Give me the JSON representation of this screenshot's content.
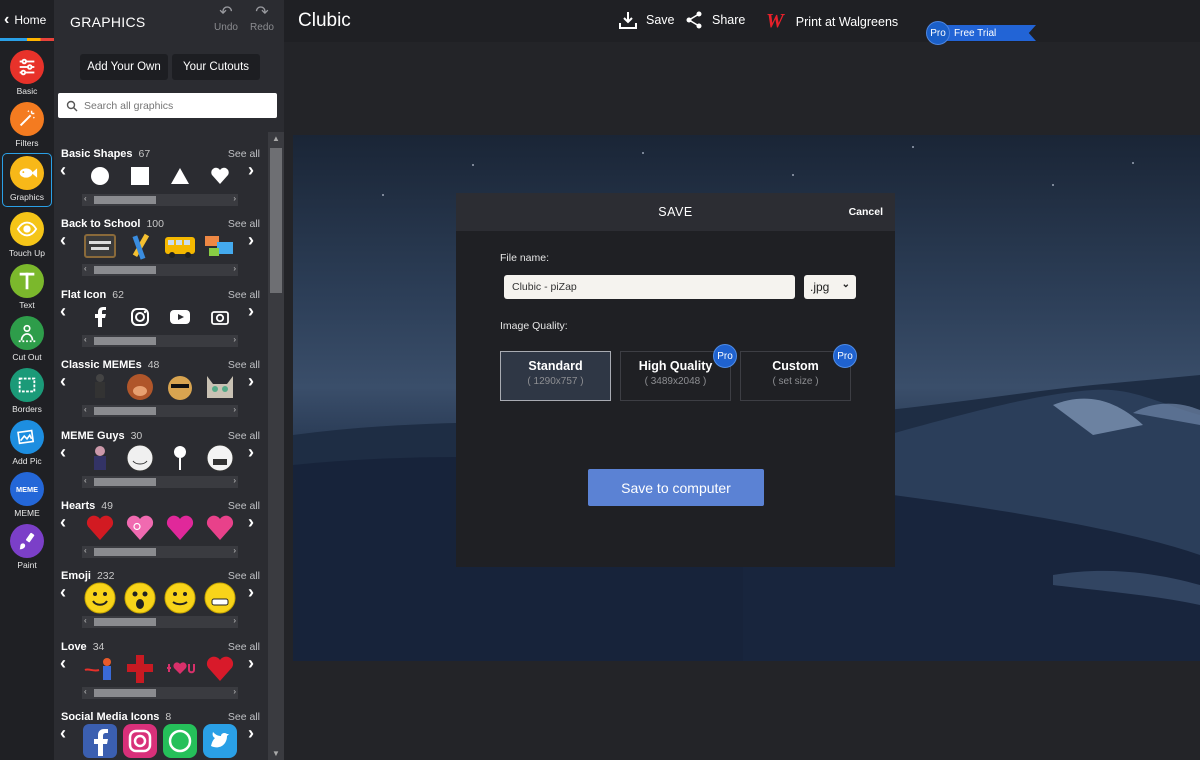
{
  "rail": {
    "home_label": "Home",
    "tools": [
      {
        "label": "Basic",
        "color": "#e8322a",
        "icon": "sliders-icon"
      },
      {
        "label": "Filters",
        "color": "#f47b20",
        "icon": "magic-wand-icon"
      },
      {
        "label": "Graphics",
        "color": "#f8b818",
        "icon": "fish-icon"
      },
      {
        "label": "Touch Up",
        "color": "#f5c518",
        "icon": "eye-icon"
      },
      {
        "label": "Text",
        "color": "#7bb82c",
        "icon": "text-t-icon"
      },
      {
        "label": "Cut Out",
        "color": "#2e9d4a",
        "icon": "cutout-person-icon"
      },
      {
        "label": "Borders",
        "color": "#1b9a78",
        "icon": "border-frame-icon"
      },
      {
        "label": "Add Pic",
        "color": "#1d8ee0",
        "icon": "add-picture-icon"
      },
      {
        "label": "MEME",
        "color": "#2467d8",
        "icon": "meme-text-icon"
      },
      {
        "label": "Paint",
        "color": "#7b3fc8",
        "icon": "paint-brush-icon"
      }
    ]
  },
  "panel": {
    "title": "GRAPHICS",
    "undo": "Undo",
    "redo": "Redo",
    "tab_own": "Add Your Own",
    "tab_cutouts": "Your Cutouts",
    "search_placeholder": "Search all graphics",
    "see_all": "See all",
    "categories": [
      {
        "name": "Basic Shapes",
        "count": "67"
      },
      {
        "name": "Back to School",
        "count": "100"
      },
      {
        "name": "Flat Icon",
        "count": "62"
      },
      {
        "name": "Classic MEMEs",
        "count": "48"
      },
      {
        "name": "MEME Guys",
        "count": "30"
      },
      {
        "name": "Hearts",
        "count": "49"
      },
      {
        "name": "Emoji",
        "count": "232"
      },
      {
        "name": "Love",
        "count": "34"
      },
      {
        "name": "Social Media Icons",
        "count": "8"
      }
    ]
  },
  "topbar": {
    "title": "Clubic",
    "save": "Save",
    "share": "Share",
    "print": "Print at Walgreens",
    "walgreens_mark": "W",
    "pro": "Pro",
    "free_trial": "Free Trial"
  },
  "modal": {
    "title": "SAVE",
    "cancel": "Cancel",
    "file_name_label": "File name:",
    "file_name_value": "Clubic - piZap",
    "extension": ".jpg",
    "quality_label": "Image Quality:",
    "qualities": [
      {
        "title": "Standard",
        "size": "( 1290x757 )"
      },
      {
        "title": "High Quality",
        "size": "( 3489x2048 )",
        "badge": "Pro"
      },
      {
        "title": "Custom",
        "size": "( set size )",
        "badge": "Pro"
      }
    ],
    "save_button": "Save to computer"
  }
}
